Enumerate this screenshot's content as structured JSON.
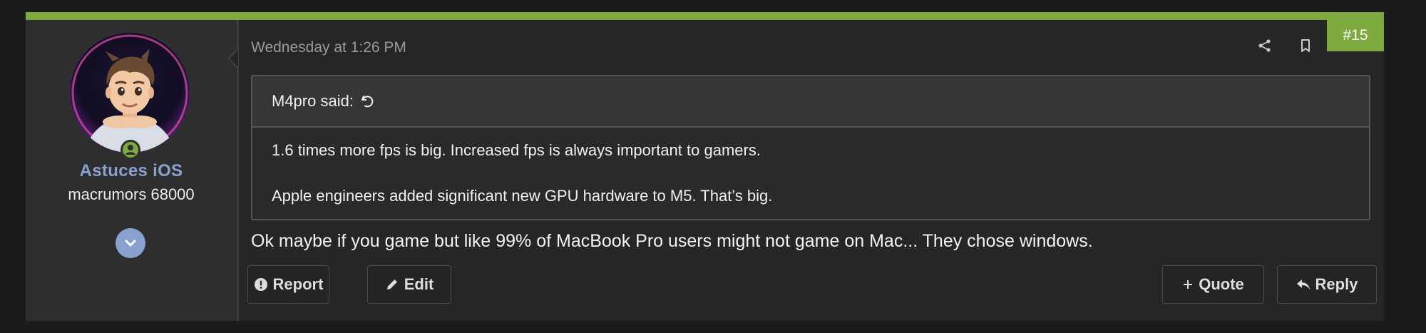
{
  "post": {
    "timestamp": "Wednesday at 1:26 PM",
    "number": "#15",
    "accent_color": "#7ea93f",
    "message": "Ok maybe if you game but like 99% of MacBook Pro users might not game on Mac... They chose windows."
  },
  "author": {
    "username": "Astuces iOS",
    "user_title": "macrumors 68000",
    "username_color": "#8aa1cf",
    "online_status_icon": "user-online-icon",
    "expand_icon": "chevron-down-icon"
  },
  "quote": {
    "author_said": "M4pro said:",
    "jump_icon": "go-to-original-icon",
    "lines": [
      "1.6 times more fps is big. Increased fps is always important to gamers.",
      "Apple engineers added significant new GPU hardware to M5. That’s big."
    ]
  },
  "actions": {
    "share_icon": "share-icon",
    "bookmark_icon": "bookmark-icon",
    "report_label": "Report",
    "edit_label": "Edit",
    "quote_label": "Quote",
    "reply_label": "Reply"
  }
}
